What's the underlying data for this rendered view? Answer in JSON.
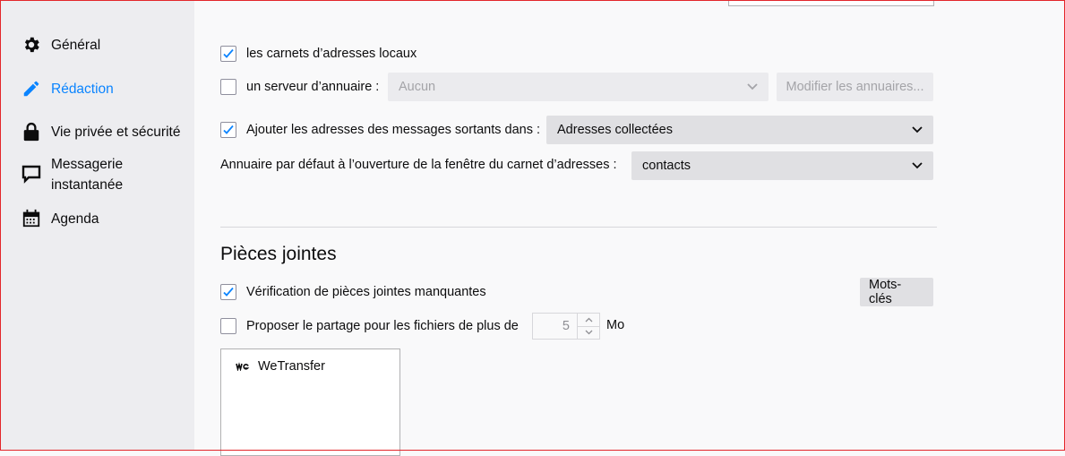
{
  "sidebar": {
    "items": [
      {
        "label": "Général",
        "icon": "gear-icon"
      },
      {
        "label": "Rédaction",
        "icon": "pencil-icon",
        "active": true
      },
      {
        "label": "Vie privée et sécurité",
        "icon": "lock-icon"
      },
      {
        "label": "Messagerie",
        "label2": "instantanée",
        "icon": "chat-icon"
      },
      {
        "label": "Agenda",
        "icon": "calendar-icon"
      }
    ]
  },
  "addressing": {
    "local_books": {
      "label": "les carnets d’adresses locaux",
      "checked": true
    },
    "directory_server": {
      "label": "un serveur d’annuaire :",
      "checked": false,
      "select_value": "Aucun",
      "edit_button": "Modifier les annuaires..."
    },
    "outgoing": {
      "label": "Ajouter les adresses des messages sortants dans :",
      "checked": true,
      "select_value": "Adresses collectées"
    },
    "default_directory": {
      "label": "Annuaire par défaut à l’ouverture de la fenêtre du carnet d’adresses :",
      "select_value": "contacts"
    }
  },
  "attachments": {
    "heading": "Pièces jointes",
    "missing_check": {
      "label": "Vérification de pièces jointes manquantes",
      "checked": true,
      "keywords_button": "Mots-clés"
    },
    "share": {
      "label": "Proposer le partage pour les fichiers de plus de",
      "checked": false,
      "value": "5",
      "unit": "Mo"
    },
    "providers": [
      {
        "name": "WeTransfer",
        "icon": "wetransfer-icon"
      }
    ]
  },
  "colors": {
    "accent": "#0a84ff",
    "frame": "#e3262b"
  }
}
